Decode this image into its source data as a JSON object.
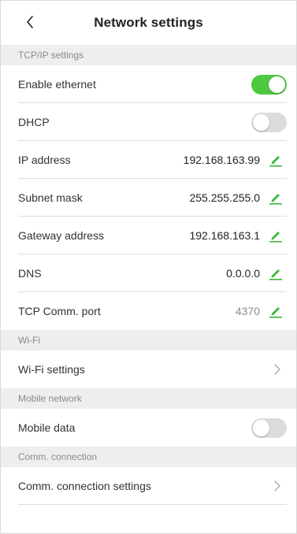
{
  "header": {
    "title": "Network settings",
    "back_icon": "chevron-left-icon"
  },
  "sections": {
    "tcpip": "TCP/IP settings",
    "wifi": "Wi-Fi",
    "mobile": "Mobile network",
    "comm": "Comm. connection"
  },
  "tcpip": {
    "enable_ethernet": {
      "label": "Enable ethernet",
      "on": true
    },
    "dhcp": {
      "label": "DHCP",
      "on": false
    },
    "ip_address": {
      "label": "IP address",
      "value": "192.168.163.99"
    },
    "subnet_mask": {
      "label": "Subnet mask",
      "value": "255.255.255.0"
    },
    "gateway": {
      "label": "Gateway address",
      "value": "192.168.163.1"
    },
    "dns": {
      "label": "DNS",
      "value": "0.0.0.0"
    },
    "tcp_port": {
      "label": "TCP Comm. port",
      "value": "4370"
    }
  },
  "wifi": {
    "settings_label": "Wi-Fi settings"
  },
  "mobile": {
    "mobile_data": {
      "label": "Mobile data",
      "on": false
    }
  },
  "comm": {
    "settings_label": "Comm. connection settings"
  },
  "colors": {
    "accent": "#4cc93e",
    "toggle_off": "#dcdcdc",
    "section_bg": "#eeeeee",
    "edit_icon": "#3db83a"
  },
  "icons": {
    "edit": "pencil-edit-icon",
    "chevron": "chevron-right-icon"
  }
}
